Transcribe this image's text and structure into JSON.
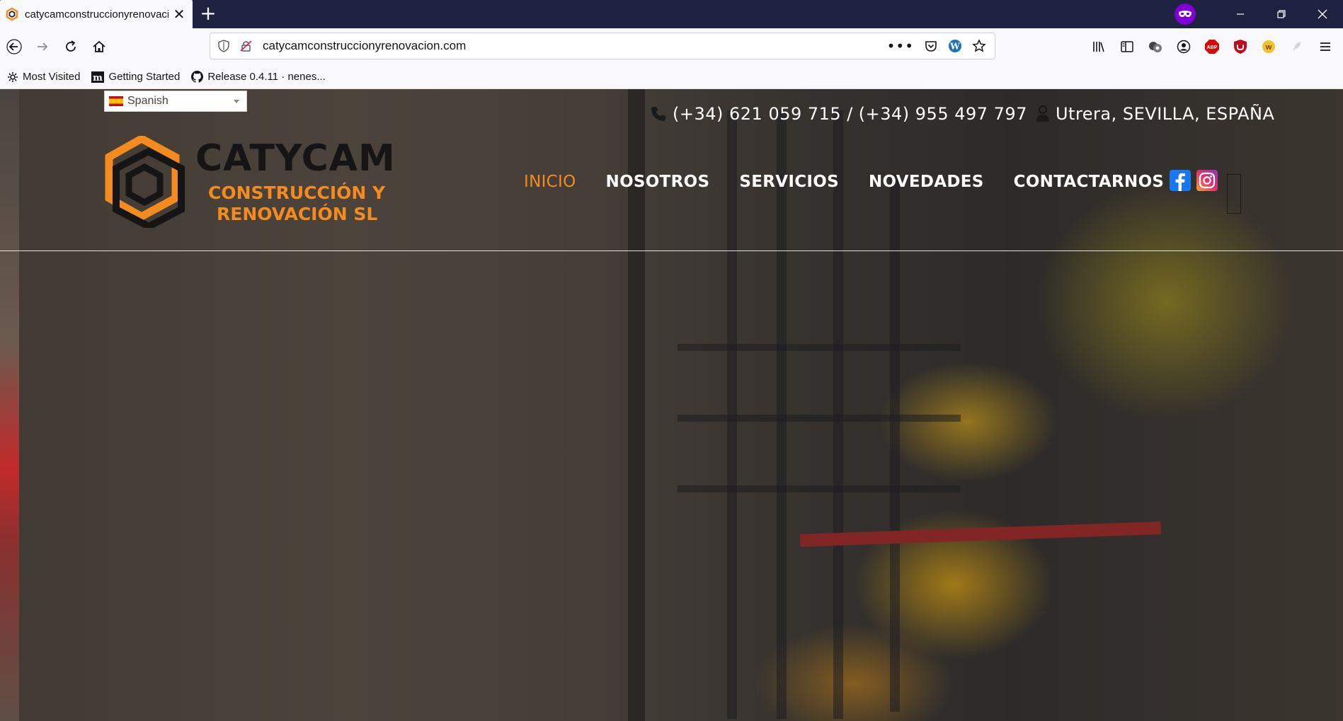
{
  "browser": {
    "tab_title": "catycamconstruccionyrenovacion.com",
    "url": "catycamconstruccionyrenovacion.com",
    "bookmarks": [
      {
        "label": "Most Visited",
        "icon": "gear-icon"
      },
      {
        "label": "Getting Started",
        "icon": "medium-icon"
      },
      {
        "label": "Release 0.4.11 · nenes...",
        "icon": "github-icon"
      }
    ],
    "private_badge_color": "#8000d7",
    "chrome_color": "#1e2241"
  },
  "site": {
    "language_selector": {
      "value": "Spanish"
    },
    "contact": {
      "phone1": "(+34) 621 059 715",
      "separator": "/",
      "phone2": "(+34) 955 497 797",
      "location": "Utrera, SEVILLA, ESPAÑA"
    },
    "logo": {
      "title": "CATYCAM",
      "subtitle_line1": "CONSTRUCCIÓN Y",
      "subtitle_line2": "RENOVACIÓN SL"
    },
    "nav": [
      {
        "label": "INICIO",
        "active": true
      },
      {
        "label": "NOSOTROS",
        "active": false
      },
      {
        "label": "SERVICIOS",
        "active": false
      },
      {
        "label": "NOVEDADES",
        "active": false
      },
      {
        "label": "CONTACTARNOS",
        "active": false
      }
    ],
    "accent_color": "#f48b1e",
    "social": [
      "facebook-icon",
      "instagram-icon"
    ]
  }
}
